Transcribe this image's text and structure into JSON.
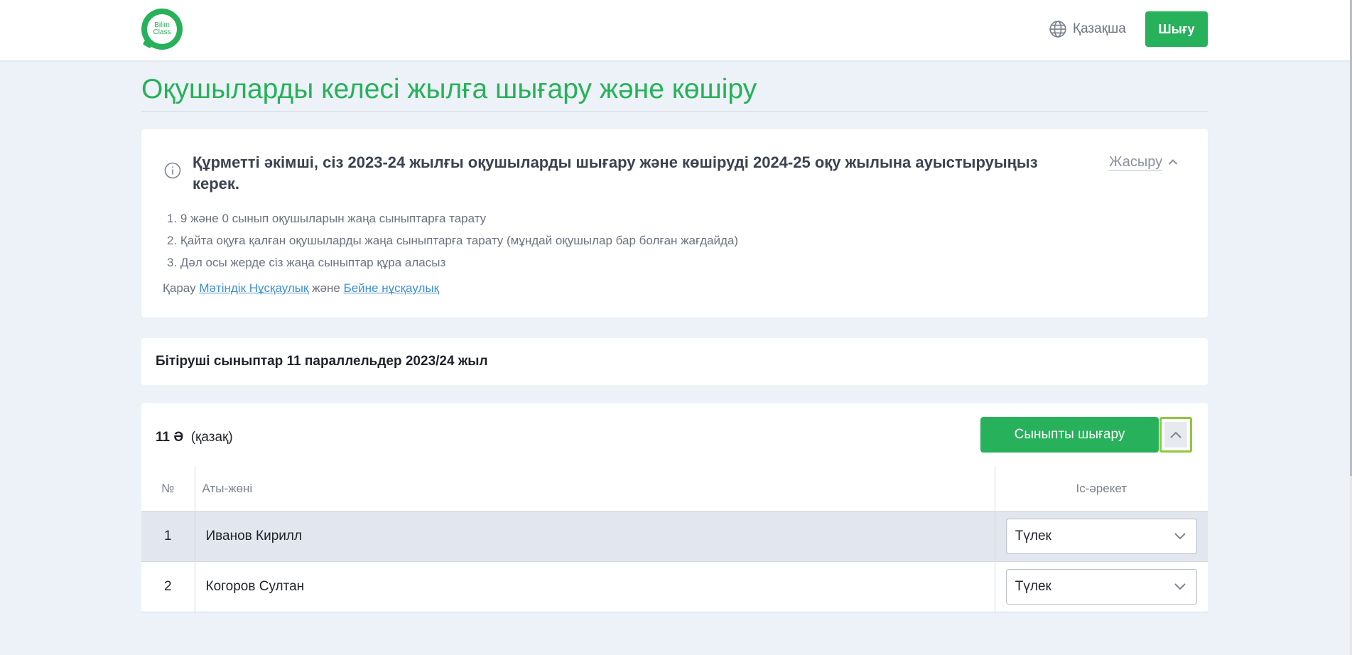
{
  "header": {
    "logo_line1": "Bilim",
    "logo_line2": "Class",
    "language": "Қазақша",
    "exit_label": "Шығу"
  },
  "page": {
    "title": "Оқушыларды келесі жылға шығару және көшіру"
  },
  "info": {
    "heading": "Құрметті әкімші, сіз 2023-24 жылғы оқушыларды шығару және көшіруді 2024-25 оқу жылына ауыстыруыңыз керек.",
    "hide_label": "Жасыру",
    "steps": [
      "1. 9 және 0 сынып оқушыларын жаңа сыныптарға тарату",
      "2. Қайта оқуға қалған оқушыларды жаңа сыныптарға тарату (мұндай оқушылар бар болған жағдайда)",
      "3. Дәл осы жерде сіз жаңа сыныптар құра аласыз"
    ],
    "view_prefix": "Қарау",
    "text_guide_link": "Мәтіндік Нұсқаулық",
    "and_word": "және",
    "video_guide_link": "Бейне нұсқаулық"
  },
  "graduates": {
    "title": "Бітіруші сыныптар 11 параллельдер 2023/24 жыл"
  },
  "class_block": {
    "class_name": "11 Ә",
    "class_lang": "(қазақ)",
    "promote_label": "Сыныпты шығару",
    "columns": {
      "num": "№",
      "name": "Аты-жөні",
      "action": "Іс-әрекет"
    },
    "rows": [
      {
        "num": "1",
        "name": "Иванов Кирилл",
        "action": "Түлек"
      },
      {
        "num": "2",
        "name": "Когоров Султан",
        "action": "Түлек"
      }
    ]
  },
  "colors": {
    "brand_green": "#27b15a",
    "focus_outline": "#8ec63f",
    "background": "#edf2f8",
    "link_blue": "#3f8fd2"
  },
  "icons": [
    "globe-icon",
    "info-icon",
    "chevron-up-icon",
    "chevron-down-icon"
  ]
}
